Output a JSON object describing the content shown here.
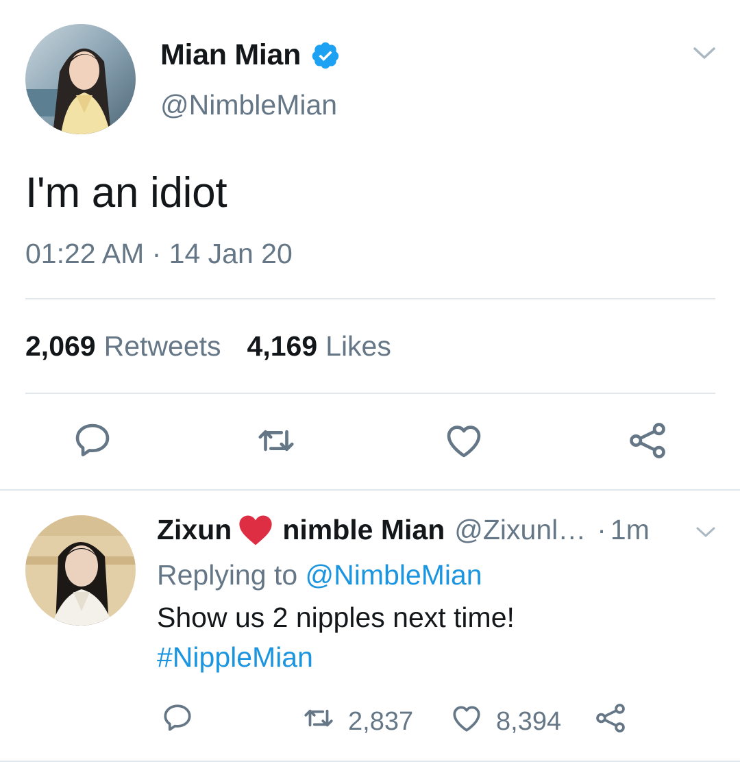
{
  "main_tweet": {
    "author": {
      "display_name": "Mian Mian",
      "handle": "@NimbleMian",
      "verified": true,
      "avatar_icon": "user-avatar"
    },
    "text": "I'm an idiot",
    "timestamp": "01:22 AM · 14 Jan 20",
    "stats": {
      "retweets_count": "2,069",
      "retweets_label": "Retweets",
      "likes_count": "4,169",
      "likes_label": "Likes"
    },
    "actions": [
      "reply-icon",
      "retweet-icon",
      "like-icon",
      "share-icon"
    ]
  },
  "reply_tweet": {
    "author": {
      "name_part1": "Zixun",
      "name_part2": "nimble Mian",
      "handle": "@Zixunl…",
      "avatar_icon": "user-avatar"
    },
    "separator": "·",
    "time": "1m",
    "replying_label": "Replying to",
    "replying_mention": "@NimbleMian",
    "text": "Show us 2 nipples next time!",
    "hashtag": "#NippleMian",
    "retweet_count": "2,837",
    "like_count": "8,394"
  },
  "colors": {
    "text": "#14171a",
    "secondary": "#657786",
    "link": "#1b95e0",
    "verified": "#1da1f2",
    "divider": "#e1e8ed",
    "heart_emoji": "#dd2e44"
  }
}
